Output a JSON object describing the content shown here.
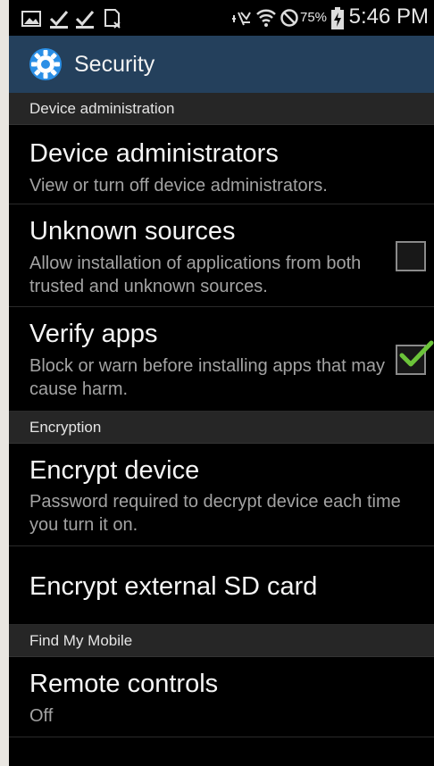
{
  "status_bar": {
    "battery_percent": "75%",
    "time": "5:46 PM",
    "icons": [
      "image-icon",
      "download-done-icon",
      "download-done-icon",
      "sd-card-icon",
      "mute-icon",
      "wifi-icon",
      "no-signal-icon",
      "battery-charging-icon"
    ]
  },
  "action_bar": {
    "title": "Security",
    "icon": "settings-gear-icon",
    "color": "#24405c"
  },
  "sections": {
    "device_admin": "Device administration",
    "encryption": "Encryption",
    "find_my_mobile": "Find My Mobile"
  },
  "items": {
    "device_administrators": {
      "title": "Device administrators",
      "subtitle": "View or turn off device administrators."
    },
    "unknown_sources": {
      "title": "Unknown sources",
      "subtitle": "Allow installation of applications from both trusted and unknown sources.",
      "checked": false
    },
    "verify_apps": {
      "title": "Verify apps",
      "subtitle": "Block or warn before installing apps that may cause harm.",
      "checked": true
    },
    "encrypt_device": {
      "title": "Encrypt device",
      "subtitle": "Password required to decrypt device each time you turn it on."
    },
    "encrypt_sd": {
      "title": "Encrypt external SD card"
    },
    "remote_controls": {
      "title": "Remote controls",
      "subtitle": "Off"
    }
  },
  "colors": {
    "check": "#6cc43a",
    "section_bg": "#262626"
  }
}
